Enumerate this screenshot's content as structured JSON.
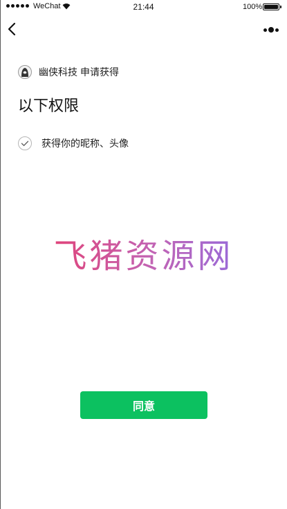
{
  "status_bar": {
    "carrier": "WeChat",
    "time": "21:44",
    "battery": "100%"
  },
  "app": {
    "name": "幽侠科技",
    "request_text": "申请获得"
  },
  "title": "以下权限",
  "permissions": [
    {
      "label": "获得你的昵称、头像",
      "checked": true
    }
  ],
  "watermark": "飞猪资源网",
  "agree_label": "同意",
  "colors": {
    "agree_button": "#0cc160",
    "watermark_start": "#e0447a",
    "watermark_end": "#9a6ad8"
  },
  "icons": {
    "back": "chevron-left-icon",
    "more": "more-dots-icon",
    "check": "check-icon"
  }
}
